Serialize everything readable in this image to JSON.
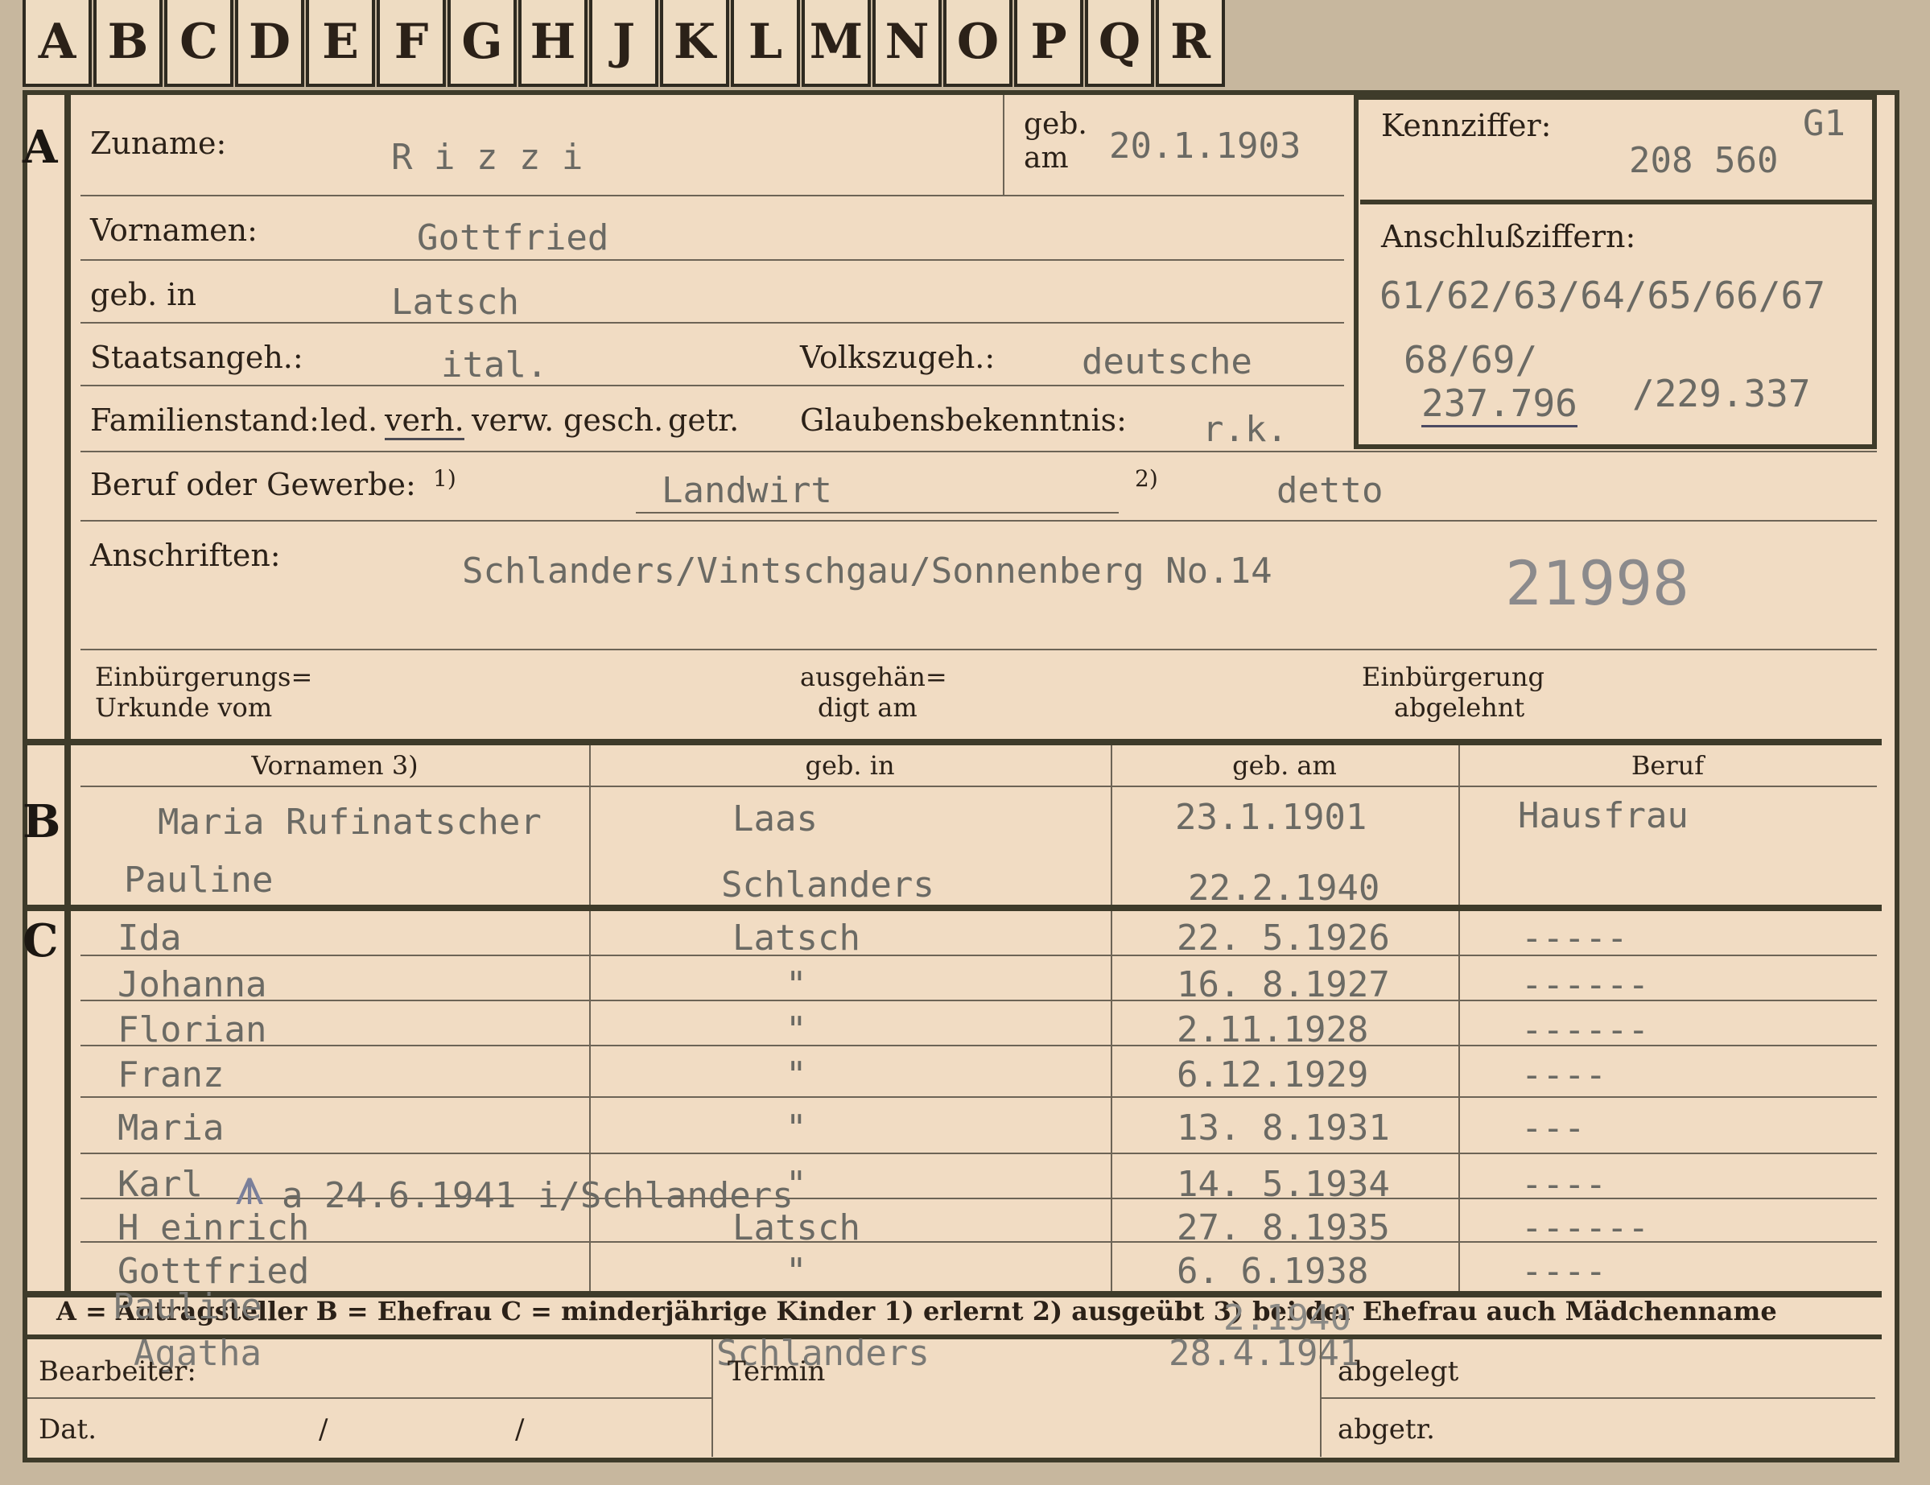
{
  "tabs": [
    "A",
    "B",
    "C",
    "D",
    "E",
    "F",
    "G",
    "H",
    "J",
    "K",
    "L",
    "M",
    "N",
    "O",
    "P",
    "Q",
    "R"
  ],
  "section_a": {
    "marker": "A",
    "zuname_label": "Zuname:",
    "zuname_value": "R i z z i",
    "geb_am_label1": "geb.",
    "geb_am_label2": "am",
    "geb_am_value": "20.1.1903",
    "vornamen_label": "Vornamen:",
    "vornamen_value": "Gottfried",
    "geb_in_label": "geb. in",
    "geb_in_value": "Latsch",
    "staatsangeh_label": "Staatsangeh.:",
    "staatsangeh_value": "ital.",
    "volkszugeh_label": "Volkszugeh.:",
    "volkszugeh_value": "deutsche",
    "familienstand_label": "Familienstand:",
    "familienstand_opt1": "led.",
    "familienstand_opt2": "verh.",
    "familienstand_opt3": "verw.",
    "familienstand_opt4": "gesch.",
    "familienstand_opt5": "getr.",
    "glauben_label": "Glaubensbekenntnis:",
    "glauben_value": "r.k.",
    "beruf_label": "Beruf oder Gewerbe:",
    "beruf_sup1": "1)",
    "beruf_value1": "Landwirt",
    "beruf_sup2": "2)",
    "beruf_value2": "detto",
    "anschriften_label": "Anschriften:",
    "anschriften_value": "Schlanders/Vintschgau/Sonnenberg No.14",
    "stamp_number": "21998",
    "einb_urkunde_l1": "Einbürgerungs=",
    "einb_urkunde_l2": "Urkunde vom",
    "ausgehaendigt_l1": "ausgehän=",
    "ausgehaendigt_l2": "digt am",
    "einb_abgelehnt_l1": "Einbürgerung",
    "einb_abgelehnt_l2": "abgelehnt"
  },
  "kennziffer": {
    "label": "Kennziffer:",
    "code": "G1",
    "value": "208 560",
    "anschluss_label": "Anschlußziffern:",
    "anschluss_line1": "61/62/63/64/65/66/67",
    "anschluss_line2": "68/69/",
    "anschluss_line3a": "237.796",
    "anschluss_line3b": "/229.337"
  },
  "section_b": {
    "marker": "B",
    "headers": [
      "Vornamen 3)",
      "geb. in",
      "geb. am",
      "Beruf"
    ],
    "rows": [
      {
        "name": "Maria Rufinatscher",
        "place": "Laas",
        "date": "23.1.1901",
        "job": "Hausfrau"
      },
      {
        "name": "Pauline",
        "place": "Schlanders",
        "date": "22.2.1940",
        "job": ""
      }
    ]
  },
  "section_c": {
    "marker": "C",
    "rows": [
      {
        "name": "Ida",
        "place": "Latsch",
        "date": "22. 5.1926",
        "job": "-----"
      },
      {
        "name": "Johanna",
        "place": "\"",
        "date": "16. 8.1927",
        "job": "------"
      },
      {
        "name": "Florian",
        "place": "\"",
        "date": "2.11.1928",
        "job": "------"
      },
      {
        "name": "Franz",
        "place": "\"",
        "date": "6.12.1929",
        "job": "----"
      },
      {
        "name": "Maria",
        "place": "\"",
        "date": "13. 8.1931",
        "job": "---"
      },
      {
        "name": "Karl",
        "place": "\"",
        "date": "14. 5.1934",
        "job": "----"
      },
      {
        "name": "H einrich",
        "place": "Latsch",
        "date": "27. 8.1935",
        "job": "------"
      },
      {
        "name": "Gottfried",
        "place": "\"",
        "date": "6. 6.1938",
        "job": "----"
      }
    ],
    "karl_note": "a 24.6.1941 i/Schlanders",
    "overflow_name1": "Pauline",
    "overflow_name2": "Agatha",
    "overflow_place": "Schlanders",
    "overflow_date1": "2.1940",
    "overflow_date2": "28.4.1941"
  },
  "legend": {
    "text": "A = Antragsteller   B = Ehefrau   C = minderjährige Kinder   1) erlernt   2) ausgeübt   3) bei der Ehefrau auch Mädchenname"
  },
  "footer": {
    "bearbeiter_label": "Bearbeiter:",
    "dat_label": "Dat.",
    "dat_slash1": "/",
    "dat_slash2": "/",
    "termin_label": "Termin",
    "abgelegt_label": "abgelegt",
    "abgetr_label": "abgetr."
  }
}
